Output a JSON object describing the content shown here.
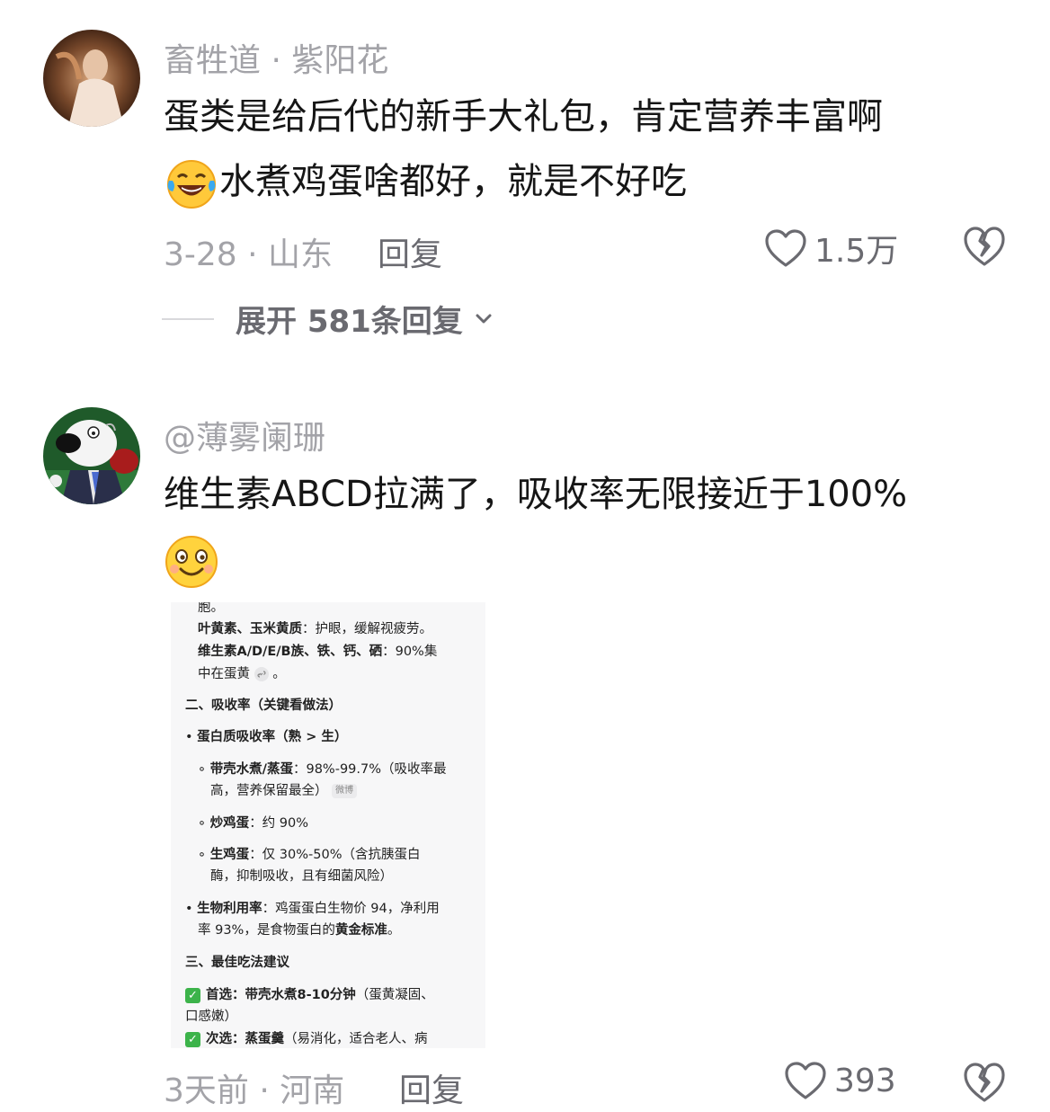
{
  "comments": [
    {
      "author": "畜牲道 · 紫阳花",
      "line1": "蛋类是给后代的新手大礼包，肯定营养丰富啊",
      "line2": "水煮鸡蛋啥都好，就是不好吃",
      "emoji": "laughing-crying-emoji",
      "meta": "3-28 · 山东",
      "reply_label": "回复",
      "likes": "1.5万",
      "expand_label": "展开 581条回复"
    },
    {
      "author": "@薄雾阑珊",
      "line1": "维生素ABCD拉满了，吸收率无限接近于100%",
      "emoji": "smiling-emoji",
      "meta": "3天前 · 河南",
      "reply_label": "回复",
      "likes": "393",
      "attachment": {
        "lines": [
          "胞。",
          "叶黄素、玉米黄质",
          "：护眼，缓解视疲劳。",
          "维生素A/D/E/B族、铁、钙、硒",
          "：90%集",
          "中在蛋黄",
          "二、吸收率（关键看做法）",
          "蛋白质吸收率（熟 > 生）",
          "带壳水煮/蒸蛋",
          "：98%-99.7%（吸收率最",
          "高，营养保留最全）",
          "微博",
          "炒鸡蛋",
          "：约 90%",
          "生鸡蛋",
          "：仅 30%-50%（含抗胰蛋白",
          "酶，抑制吸收，且有细菌风险）",
          "生物利用率",
          "：鸡蛋蛋白生物价 94，净利用",
          "率 93%，是食物蛋白的",
          "黄金标准",
          "三、最佳吃法建议",
          "首选：带壳水煮8-10分钟",
          "（蛋黄凝固、",
          "口感嫩）",
          "次选：蒸蛋羹",
          "（易消化，适合老人、病"
        ]
      }
    }
  ],
  "colors": {
    "secondary_text": "#a3a3a8",
    "action_text": "#6a6a70",
    "body_text": "#161616"
  }
}
